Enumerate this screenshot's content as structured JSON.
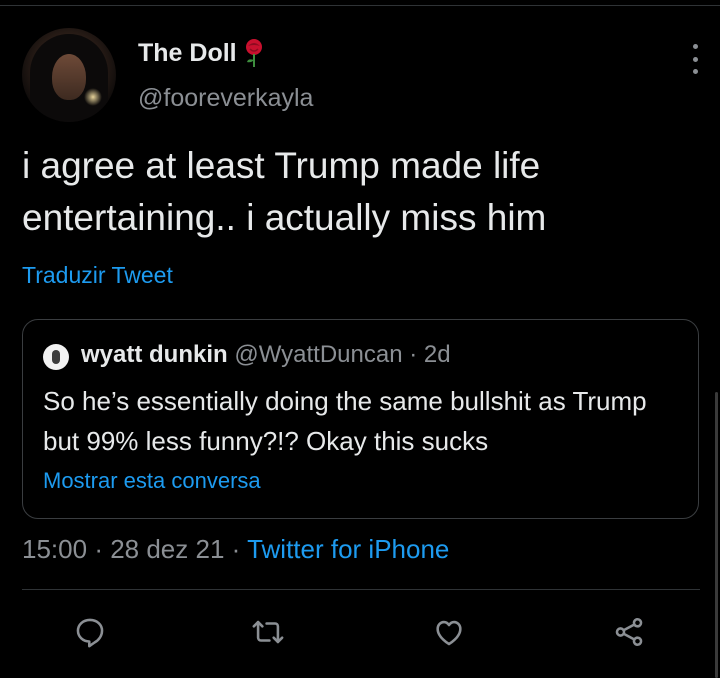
{
  "tweet": {
    "author_name": "The Doll",
    "author_handle": "@fooreverkayla",
    "text": "i agree at least Trump made life entertaining.. i actually miss him",
    "translate_label": "Traduzir Tweet",
    "time": "15:00",
    "date": "28 dez 21",
    "source": "Twitter for iPhone"
  },
  "quoted": {
    "name": "wyatt dunkin",
    "handle": "@WyattDuncan",
    "age": "2d",
    "text": "So he’s essentially doing the same bullshit as Trump but 99% less funny?!? Okay this sucks",
    "show_thread_label": "Mostrar esta conversa"
  },
  "icons": {
    "name_emoji": "rose-icon",
    "more": "more-icon",
    "actions": [
      "reply-icon",
      "retweet-icon",
      "like-icon",
      "share-icon"
    ]
  },
  "colors": {
    "background": "#000000",
    "link": "#1d9bf0",
    "secondary_text": "#8b8f94",
    "rose": "#c8102e"
  }
}
